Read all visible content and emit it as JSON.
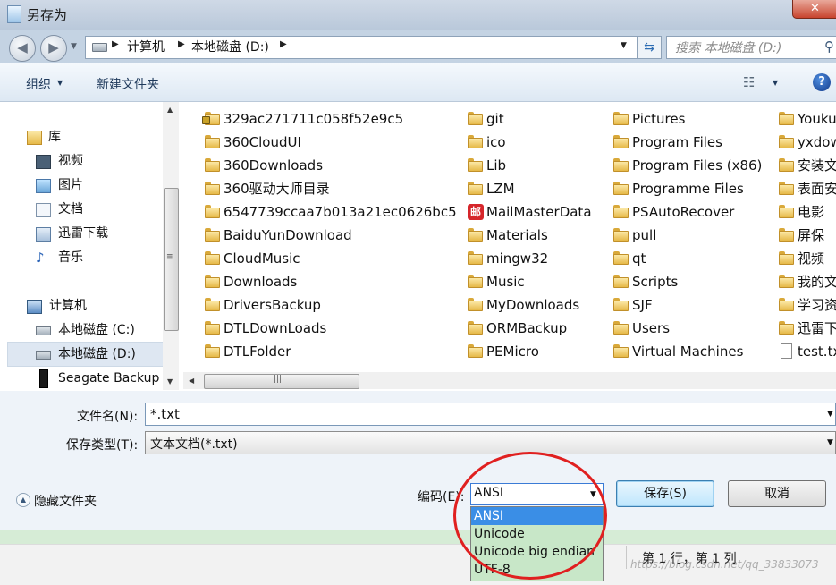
{
  "window": {
    "title": "另存为",
    "close_label": "✕"
  },
  "address": {
    "crumbs": [
      "计算机",
      "本地磁盘 (D:)"
    ],
    "search_placeholder": "搜索 本地磁盘 (D:)"
  },
  "toolbar": {
    "organize_label": "组织",
    "new_folder_label": "新建文件夹"
  },
  "nav": {
    "libraries": "库",
    "items": [
      "视频",
      "图片",
      "文档",
      "迅雷下载",
      "音乐"
    ],
    "computer": "计算机",
    "drives": [
      "本地磁盘 (C:)",
      "本地磁盘 (D:)",
      "Seagate Backup"
    ]
  },
  "files": {
    "col1": [
      "329ac271711c058f52e9c5",
      "360CloudUI",
      "360Downloads",
      "360驱动大师目录",
      "6547739ccaa7b013a21ec0626bc5",
      "BaiduYunDownload",
      "CloudMusic",
      "Downloads",
      "DriversBackup",
      "DTLDownLoads",
      "DTLFolder"
    ],
    "col2": [
      "git",
      "ico",
      "Lib",
      "LZM",
      "MailMasterData",
      "Materials",
      "mingw32",
      "Music",
      "MyDownloads",
      "ORMBackup",
      "PEMicro"
    ],
    "col3": [
      "Pictures",
      "Program Files",
      "Program Files (x86)",
      "Programme Files",
      "PSAutoRecover",
      "pull",
      "qt",
      "Scripts",
      "SJF",
      "Users",
      "Virtual Machines"
    ],
    "col4": [
      "Youku",
      "yxdow",
      "安装文",
      "表面安",
      "电影",
      "屏保",
      "视频",
      "我的文",
      "学习资",
      "迅雷下",
      "test.tx"
    ]
  },
  "form": {
    "filename_label": "文件名(N):",
    "filename_value": "*.txt",
    "filetype_label": "保存类型(T):",
    "filetype_value": "文本文档(*.txt)",
    "hide_folders_label": "隐藏文件夹",
    "encoding_label": "编码(E):",
    "encoding_value": "ANSI",
    "encoding_options": [
      "ANSI",
      "Unicode",
      "Unicode big endian",
      "UTF-8"
    ],
    "save_label": "保存(S)",
    "cancel_label": "取消"
  },
  "statusbar": {
    "cursor_position": "第 1 行，第 1 列",
    "watermark": "https://blog.csdn.net/qq_33833073"
  },
  "colors": {
    "highlight_ellipse": "#e02020",
    "selected_option": "#3a8ee6",
    "dropdown_bg": "#c8e7c8"
  }
}
